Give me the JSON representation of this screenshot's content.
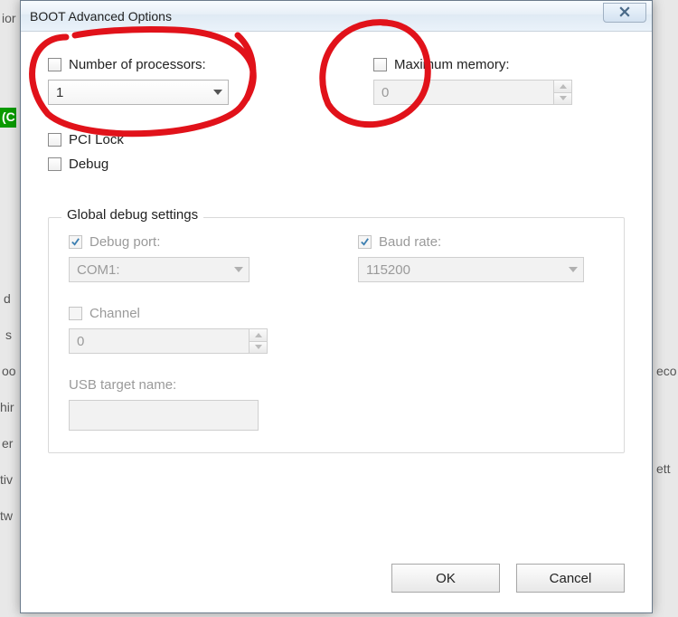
{
  "window": {
    "title": "BOOT Advanced Options"
  },
  "top": {
    "num_processors": {
      "label": "Number of processors:",
      "value": "1"
    },
    "max_memory": {
      "label": "Maximum memory:",
      "value": "0"
    },
    "pci_lock": {
      "label": "PCI Lock"
    },
    "debug": {
      "label": "Debug"
    }
  },
  "group": {
    "title": "Global debug settings",
    "debug_port": {
      "label": "Debug port:",
      "value": "COM1:"
    },
    "baud_rate": {
      "label": "Baud rate:",
      "value": "115200"
    },
    "channel": {
      "label": "Channel",
      "value": "0"
    },
    "usb_target": {
      "label": "USB target name:"
    }
  },
  "buttons": {
    "ok": "OK",
    "cancel": "Cancel"
  },
  "bg_hints": {
    "a": "ior",
    "b": "(C",
    "c": "d",
    "d": "s",
    "e": "oo",
    "f": "hir",
    "g": "er",
    "h": "tiv",
    "i": "tw",
    "j": "eco",
    "k": "ett"
  }
}
